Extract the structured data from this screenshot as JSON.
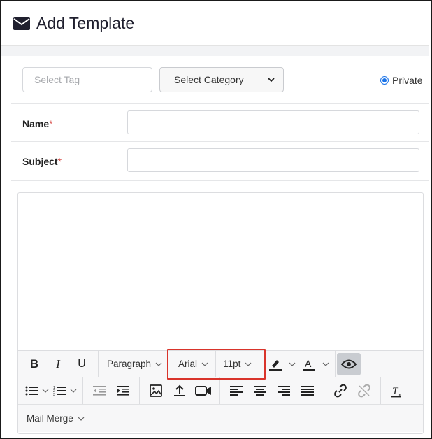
{
  "header": {
    "title": "Add Template",
    "icon": "envelope-icon"
  },
  "form": {
    "tag_placeholder": "Select Tag",
    "category_selected": "Select Category",
    "private_label": "Private",
    "private_checked": true,
    "name_label": "Name",
    "subject_label": "Subject",
    "required_mark": "*"
  },
  "toolbar": {
    "format_block": "Paragraph",
    "font_family": "Arial",
    "font_size": "11pt",
    "mail_merge": "Mail Merge"
  },
  "colors": {
    "accent": "#1a73e8",
    "required": "#d9534f",
    "highlight_box": "#d9342b"
  }
}
